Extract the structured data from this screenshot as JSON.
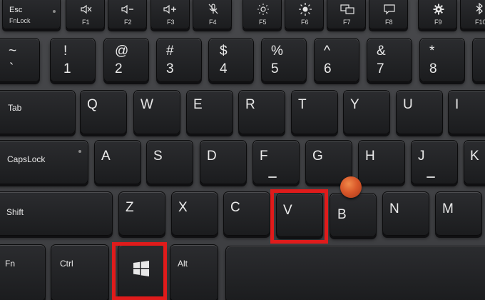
{
  "function_row": {
    "esc": {
      "top": "Esc",
      "bottom": "FnLock"
    },
    "f1": "F1",
    "f2": "F2",
    "f3": "F3",
    "f4": "F4",
    "f5": "F5",
    "f6": "F6",
    "f7": "F7",
    "f8": "F8",
    "f9": "F9",
    "f10": "F10"
  },
  "number_row": [
    {
      "shift": "~",
      "main": "`"
    },
    {
      "shift": "!",
      "main": "1"
    },
    {
      "shift": "@",
      "main": "2"
    },
    {
      "shift": "#",
      "main": "3"
    },
    {
      "shift": "$",
      "main": "4"
    },
    {
      "shift": "%",
      "main": "5"
    },
    {
      "shift": "^",
      "main": "6"
    },
    {
      "shift": "&",
      "main": "7"
    },
    {
      "shift": "*",
      "main": "8"
    }
  ],
  "qwerty_row": {
    "tab": "Tab",
    "letters": [
      "Q",
      "W",
      "E",
      "R",
      "T",
      "Y",
      "U",
      "I"
    ]
  },
  "home_row": {
    "caps": "CapsLock",
    "letters": [
      "A",
      "S",
      "D",
      "F",
      "G",
      "H",
      "J",
      "K"
    ]
  },
  "bottom_letter_row": {
    "shift": "Shift",
    "letters": [
      "Z",
      "X",
      "C",
      "V",
      "B",
      "N",
      "M"
    ]
  },
  "modifier_row": {
    "fn": "Fn",
    "ctrl": "Ctrl",
    "alt": "Alt"
  },
  "highlights": [
    "windows-key",
    "v-key"
  ],
  "colors": {
    "highlight": "#e01b1b",
    "trackpoint": "#d9582a",
    "key": "#222326",
    "deck": "#434447"
  }
}
